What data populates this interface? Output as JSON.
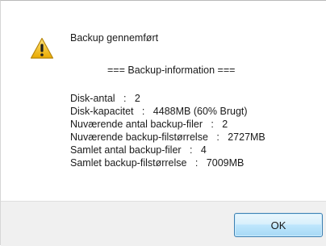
{
  "dialog": {
    "title": "Backup gennemført",
    "header": "=== Backup-information ===",
    "info_lines": [
      "Disk-antal   :   2",
      "Disk-kapacitet   :   4488MB (60% Brugt)",
      "Nuværende antal backup-filer   :   2",
      "Nuværende backup-filstørrelse   :   2727MB",
      "Samlet antal backup-filer   :   4",
      "Samlet backup-filstørrelse   :   7009MB"
    ],
    "ok_label": "OK",
    "icon": "warning-icon"
  },
  "colors": {
    "footer_bg": "#f0f0f0",
    "warning_yellow": "#f4c51d",
    "button_border": "#3c7fb1"
  }
}
